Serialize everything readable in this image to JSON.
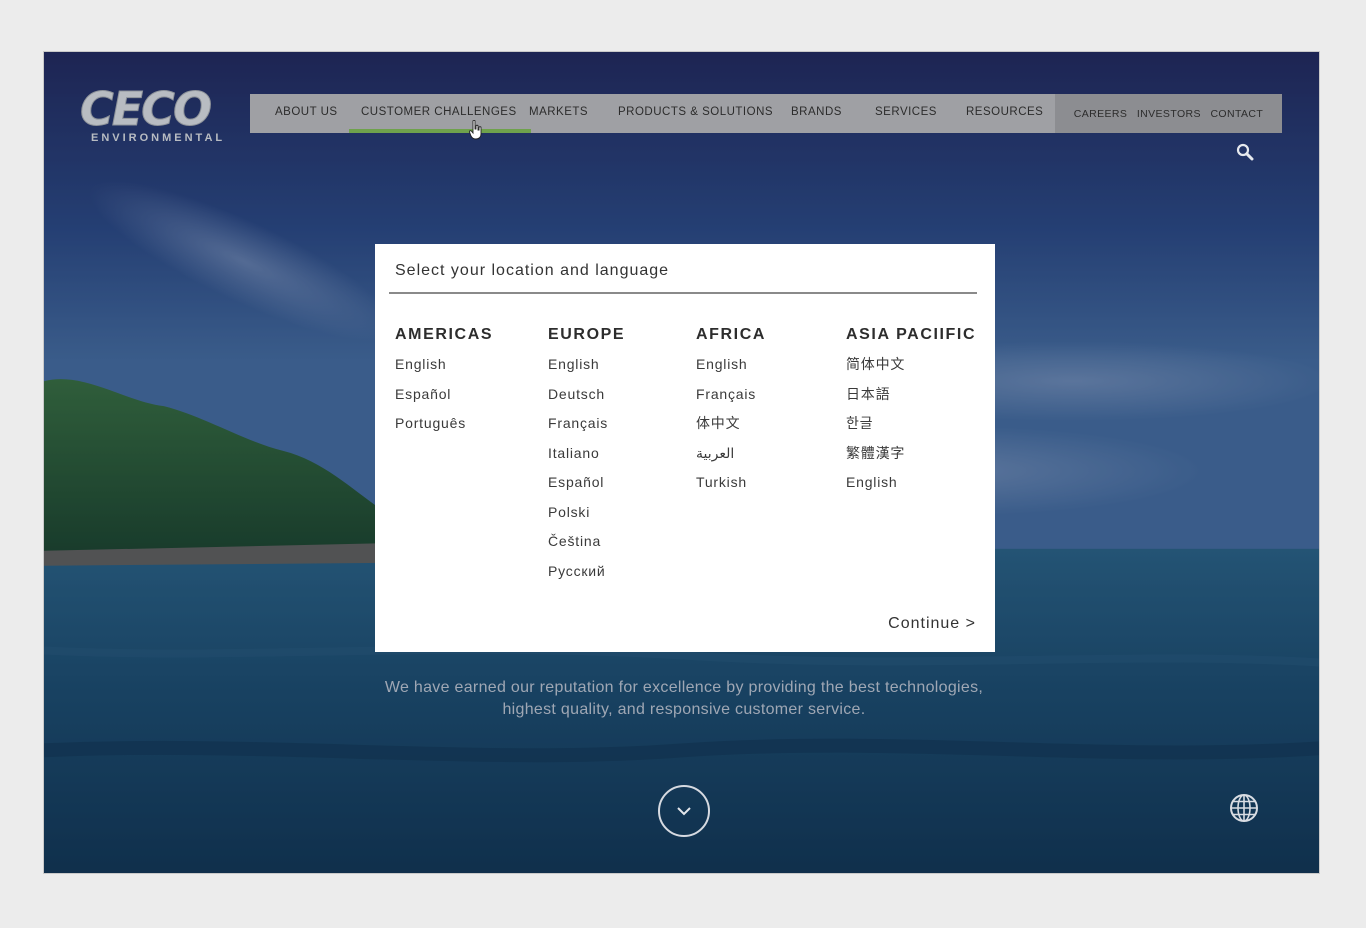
{
  "header": {
    "logo": {
      "name": "CECO",
      "tagline": "ENVIRONMENTAL"
    },
    "nav": [
      {
        "label": "ABOUT US"
      },
      {
        "label": "CUSTOMER CHALLENGES"
      },
      {
        "label": "MARKETS"
      },
      {
        "label": "PRODUCTS & SOLUTIONS"
      },
      {
        "label": "BRANDS"
      },
      {
        "label": "SERVICES"
      },
      {
        "label": "RESOURCES"
      }
    ],
    "active_nav": "CUSTOMER CHALLENGES",
    "utility_nav": [
      {
        "label": "CAREERS"
      },
      {
        "label": "INVESTORS"
      },
      {
        "label": "CONTACT"
      }
    ],
    "search_icon": "search-icon"
  },
  "hero": {
    "body": "We have earned our reputation for excellence by providing the best technologies, highest quality, and responsive customer service."
  },
  "modal": {
    "title": "Select your location and language",
    "regions": [
      {
        "name": "AMERICAS",
        "languages": [
          "English",
          "Español",
          "Português"
        ]
      },
      {
        "name": "EUROPE",
        "languages": [
          "English",
          "Deutsch",
          "Français",
          "Italiano",
          "Español",
          "Polski",
          "Čeština",
          "Русский"
        ]
      },
      {
        "name": "AFRICA",
        "languages": [
          "English",
          "Français",
          "体中文",
          "العربية",
          "Turkish"
        ]
      },
      {
        "name": "ASIA PACIIFIC",
        "languages": [
          "简体中文",
          "日本語",
          "한글",
          "繁體漢字",
          "English"
        ]
      }
    ],
    "continue_label": "Continue >"
  },
  "colors": {
    "active_underline": "#6fa24c",
    "nav_bg": "#aaaaaa",
    "modal_bg": "#ffffff"
  }
}
